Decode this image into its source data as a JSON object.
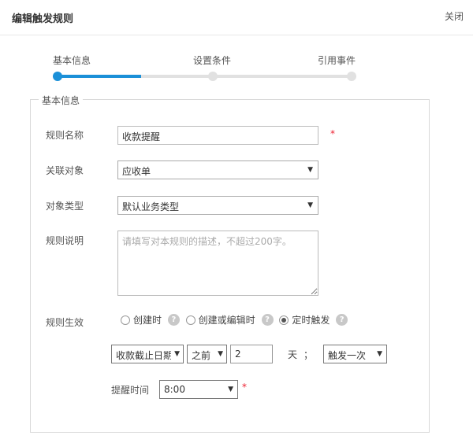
{
  "header": {
    "title": "编辑触发规则",
    "close_label": "关闭"
  },
  "steps": [
    {
      "label": "基本信息",
      "active": true
    },
    {
      "label": "设置条件",
      "active": false
    },
    {
      "label": "引用事件",
      "active": false
    }
  ],
  "section": {
    "legend": "基本信息"
  },
  "form": {
    "rule_name": {
      "label": "规则名称",
      "value": "收款提醒",
      "required_mark": "*"
    },
    "related_object": {
      "label": "关联对象",
      "value": "应收单"
    },
    "object_type": {
      "label": "对象类型",
      "value": "默认业务类型"
    },
    "description": {
      "label": "规则说明",
      "placeholder": "请填写对本规则的描述，不超过200字。"
    },
    "effect": {
      "label": "规则生效",
      "options": [
        {
          "label": "创建时",
          "checked": false
        },
        {
          "label": "创建或编辑时",
          "checked": false
        },
        {
          "label": "定时触发",
          "checked": true
        }
      ]
    },
    "schedule": {
      "date_field": "收款截止日期",
      "relation": "之前",
      "amount": "2",
      "unit": "天",
      "separator": "；",
      "frequency": "触发一次"
    },
    "remind_time": {
      "label": "提醒时间",
      "value": "8:00",
      "required_mark": "*"
    }
  },
  "colors": {
    "accent": "#1b90d8",
    "required": "#ee2233"
  },
  "icons": {
    "help": "question-circle-icon",
    "dropdown": "caret-down-icon"
  }
}
